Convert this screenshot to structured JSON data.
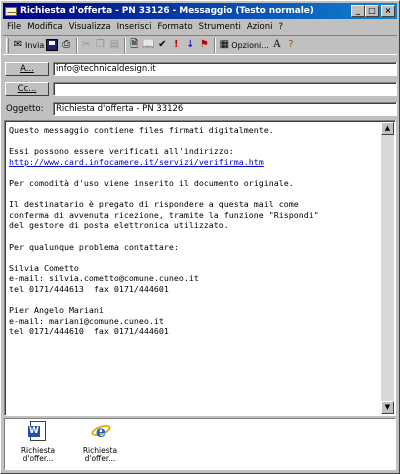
{
  "window": {
    "title": "Richiesta d'offerta - PN 33126 - Messaggio (Testo normale)",
    "minimize": "_",
    "maximize": "□",
    "close": "×"
  },
  "menu": [
    "File",
    "Modifica",
    "Visualizza",
    "Inserisci",
    "Formato",
    "Strumenti",
    "Azioni",
    "?"
  ],
  "toolbar": {
    "send_label": "Invia",
    "options_label": "Opzioni..."
  },
  "header": {
    "to_button": "A...",
    "to_value": "info@technicaldesign.it",
    "cc_button": "Cc...",
    "cc_value": "",
    "subject_label": "Oggetto:",
    "subject_value": "Richiesta d'offerta - PN 33126"
  },
  "body": {
    "line1": "Questo messaggio contiene files firmati digitalmente.",
    "line2": "Essi possono essere verificati all'indirizzo:",
    "link": "http://www.card.infocamere.it/servizi/verifirma.htm",
    "line3": "Per comodità d'uso viene inserito il documento originale.",
    "line4": "Il destinatario è pregato di rispondere a questa mail come\nconferma di avvenuta ricezione, tramite la funzione \"Rispondi\"\ndel gestore di posta elettronica utilizzato.",
    "line5": "Per qualunque problema contattare:",
    "contact1": "Silvia Cometto\ne-mail: silvia.cometto@comune.cuneo.it\ntel 0171/444613  fax 0171/444601",
    "contact2": "Pier Angelo Mariani\ne-mail: mariani@comune.cuneo.it\ntel 0171/444610  fax 0171/444601"
  },
  "attachments": [
    {
      "label": "Richiesta\nd'offer...",
      "icon": "word-document-icon"
    },
    {
      "label": "Richiesta\nd'offer...",
      "icon": "signed-file-icon"
    }
  ]
}
